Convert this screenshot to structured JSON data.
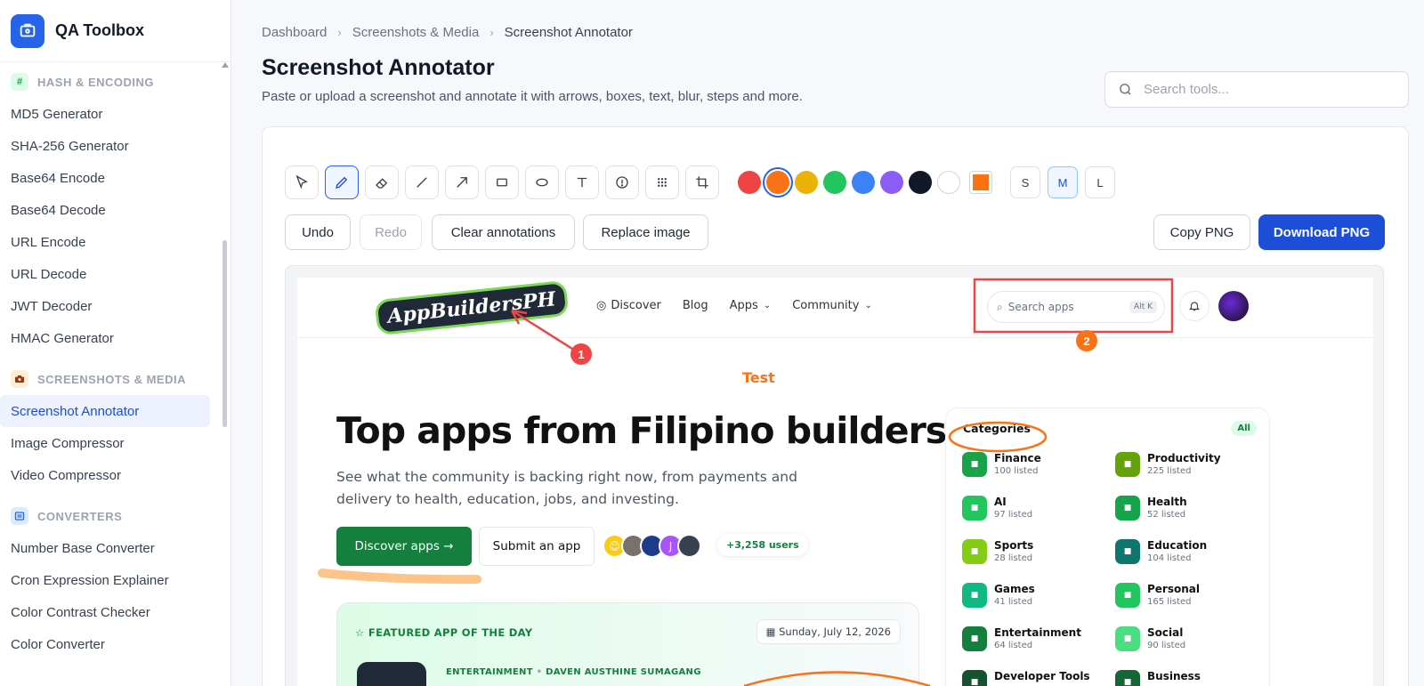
{
  "app": {
    "name": "QA Toolbox"
  },
  "sidebar": {
    "sections": [
      {
        "label": "HASH & ENCODING",
        "icon": "#",
        "color": "#16a34a",
        "bg": "#dcfce7",
        "items": [
          "MD5 Generator",
          "SHA-256 Generator",
          "Base64 Encode",
          "Base64 Decode",
          "URL Encode",
          "URL Decode",
          "JWT Decoder",
          "HMAC Generator"
        ]
      },
      {
        "label": "SCREENSHOTS & MEDIA",
        "icon": "camera-icon",
        "color": "#ea580c",
        "bg": "#ffedd5",
        "items": [
          "Screenshot Annotator",
          "Image Compressor",
          "Video Compressor"
        ]
      },
      {
        "label": "CONVERTERS",
        "icon": "converter-icon",
        "color": "#2563eb",
        "bg": "#dbeafe",
        "items": [
          "Number Base Converter",
          "Cron Expression Explainer",
          "Color Contrast Checker",
          "Color Converter"
        ]
      }
    ],
    "active_item": "Screenshot Annotator"
  },
  "breadcrumb": [
    "Dashboard",
    "Screenshots & Media",
    "Screenshot Annotator"
  ],
  "page": {
    "title": "Screenshot Annotator",
    "subtitle": "Paste or upload a screenshot and annotate it with arrows, boxes, text, blur, steps and more."
  },
  "search": {
    "placeholder": "Search tools..."
  },
  "toolbar": {
    "tools": [
      "select-icon",
      "pen-icon",
      "eraser-icon",
      "line-icon",
      "arrow-icon",
      "rectangle-icon",
      "ellipse-icon",
      "text-icon",
      "step-icon",
      "blur-icon",
      "crop-icon"
    ],
    "active_tool": "pen-icon",
    "colors": [
      "#ef4444",
      "#f97316",
      "#eab308",
      "#22c55e",
      "#3b82f6",
      "#8b5cf6",
      "#111827",
      "#ffffff"
    ],
    "selected_color": "#f97316",
    "custom_color": "#f97316",
    "sizes": [
      "S",
      "M",
      "L"
    ],
    "active_size": "M"
  },
  "actions": {
    "undo": "Undo",
    "redo": "Redo",
    "clear": "Clear annotations",
    "replace": "Replace image",
    "copy": "Copy PNG",
    "download": "Download PNG"
  },
  "screenshot": {
    "logo": "AppBuildersPH",
    "nav_links": [
      "Discover",
      "Blog",
      "Apps",
      "Community"
    ],
    "search_placeholder": "Search apps",
    "search_shortcut": "Alt K",
    "test_label": "Test",
    "hero_title": "Top apps from Filipino builders",
    "hero_sub": "See what the community is backing right now, from payments and delivery to health, education, jobs, and investing.",
    "discover_btn": "Discover apps →",
    "submit_btn": "Submit an app",
    "avatar_letter": "J",
    "users_count": "+3,258 users",
    "featured_label": "FEATURED APP OF THE DAY",
    "featured_date": "Sunday, July 12, 2026",
    "featured_category": "ENTERTAINMENT",
    "featured_author": "DAVEN AUSTHINE SUMAGANG",
    "categories_title": "Categories",
    "categories_all": "All",
    "categories": [
      {
        "name": "Finance",
        "count": "100 listed",
        "color": "#16a34a"
      },
      {
        "name": "Productivity",
        "count": "225 listed",
        "color": "#65a30d"
      },
      {
        "name": "AI",
        "count": "97 listed",
        "color": "#22c55e"
      },
      {
        "name": "Health",
        "count": "52 listed",
        "color": "#16a34a"
      },
      {
        "name": "Sports",
        "count": "28 listed",
        "color": "#84cc16"
      },
      {
        "name": "Education",
        "count": "104 listed",
        "color": "#0f766e"
      },
      {
        "name": "Games",
        "count": "41 listed",
        "color": "#10b981"
      },
      {
        "name": "Personal",
        "count": "165 listed",
        "color": "#22c55e"
      },
      {
        "name": "Entertainment",
        "count": "64 listed",
        "color": "#15803d"
      },
      {
        "name": "Social",
        "count": "90 listed",
        "color": "#4ade80"
      },
      {
        "name": "Developer Tools",
        "count": "",
        "color": "#14532d"
      },
      {
        "name": "Business",
        "count": "",
        "color": "#166534"
      }
    ]
  },
  "annotations": {
    "step_1": "1",
    "step_2": "2"
  }
}
